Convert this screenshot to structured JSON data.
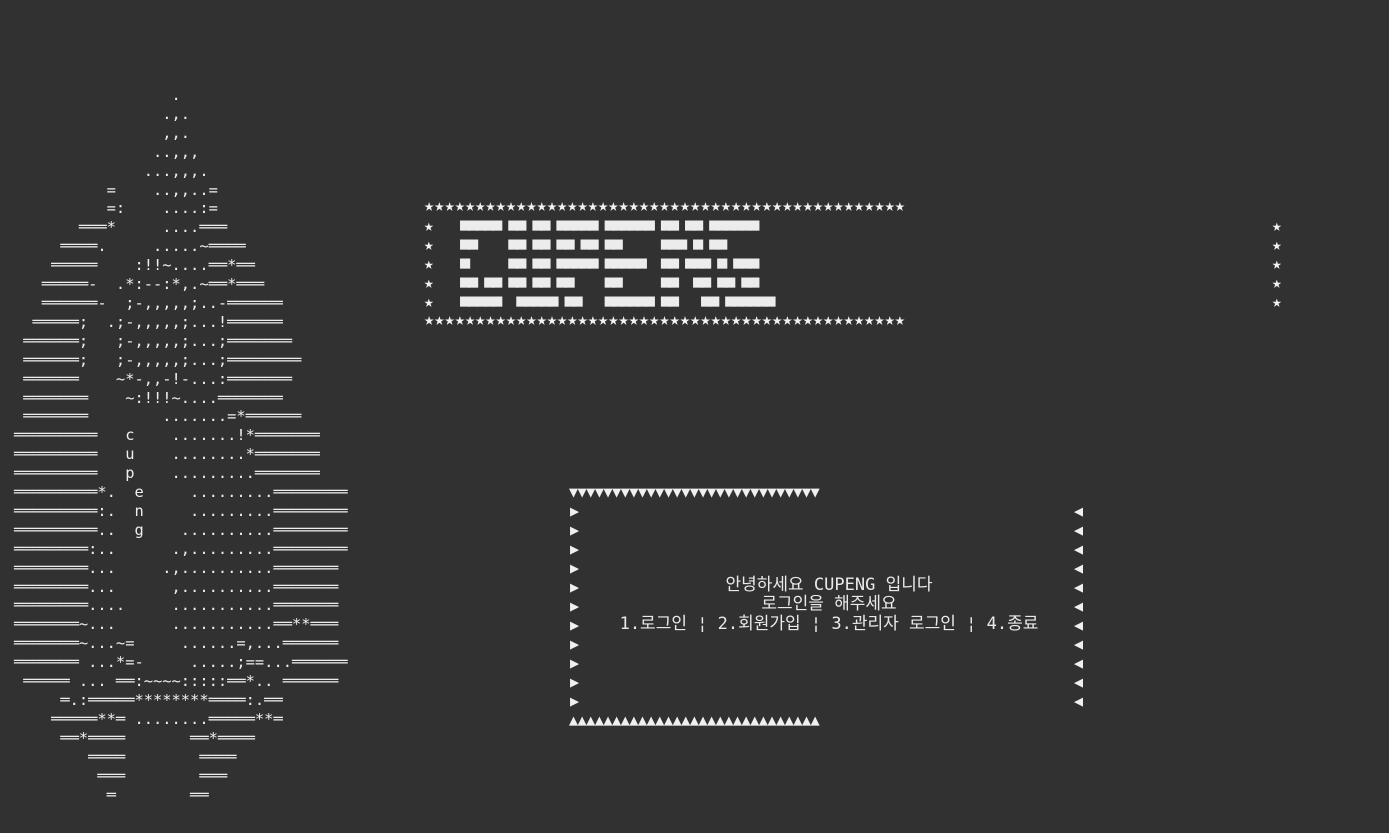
{
  "ascii_art": {
    "lines": [
      "                 .",
      "                .,.",
      "                ,,.",
      "               ..,,,",
      "              ...,,,.",
      "          =    ..,,..=",
      "          =:    ....:=",
      "       ═══*     ....═══",
      "     ════.     .....~════",
      "    ═════    :!!~....══*══",
      "   ═════-  .*:--:*,.~══*═══",
      "   ══════-  ;-,,,,,;..-══════",
      "  ═════;  .;-,,,,,;...!══════",
      " ══════;   ;-,,,,,;...;═══════",
      " ══════;   ;-,,,,,;...;════════",
      " ══════    ~*-,,-!-...:═══════",
      " ═══════    ~:!!!~....═══════",
      " ═══════        .......=*══════",
      "═════════   c    .......!*═══════",
      "═════════   u    ........*═══════",
      "═════════   p    .........═══════",
      "═════════*.  e     .........════════",
      "═════════:.  n     .........════════",
      "═════════..  g    ..........════════",
      "════════:..      .,.........════════",
      "════════...     .,..........═══════",
      "════════...      ,..........═══════",
      "════════....     ...........═══════",
      "═══════~...      ...........══**═══",
      "═══════~...~=     ......=,...══════",
      "═══════ ...*=-     .....;==...══════",
      " ═════ ... ══:~~~~:::::══*.. ══════",
      "     ═.:═════********════:.══",
      "    ═════**═ ........═════**═",
      "     ══*════       ══*════",
      "        ════        ════",
      "         ═══        ═══",
      "          ═        ══"
    ]
  },
  "banner": {
    "star_rows": {
      "top": "★★★★★★★★★★★★★★★★★★★★★★★★★★★★★★★★★★★★★★★★★★★★★★★",
      "bottom": "★★★★★★★★★★★★★★★★★★★★★★★★★★★★★★★★★★★★★★★★★★★★★★★"
    },
    "side_star": "★",
    "word": "CUPENG",
    "letter_rows": [
      "■■■■■ ■■ ■■ ■■■■■ ■■■■■■ ■■ ■■ ■■■■■■",
      "■■    ■■ ■■ ■■ ■■ ■■     ■■■ ■ ■■",
      "■     ■■ ■■ ■■■■■ ■■■■■  ■■ ■■■ ■ ■■■",
      "■■ ■■ ■■ ■■ ■■    ■■     ■■  ■■ ■■ ■■",
      "■■■■■  ■■■■■ ■■   ■■■■■■ ■■   ■■ ■■■■■■"
    ]
  },
  "menu": {
    "top_edge": "▼▼▼▼▼▼▼▼▼▼▼▼▼▼▼▼▼▼▼▼▼▼▼▼▼▼▼▼▼",
    "bottom_edge": "▲▲▲▲▲▲▲▲▲▲▲▲▲▲▲▲▲▲▲▲▲▲▲▲▲▲▲▲▲",
    "left_marker": "▶",
    "right_marker": "◀",
    "greeting": "안녕하세요 CUPENG 입니다",
    "prompt": "로그인을 해주세요",
    "options": "1.로그인 ¦ 2.회원가입 ¦ 3.관리자 로그인 ¦ 4.종료"
  },
  "colors": {
    "background": "#313131",
    "text": "#e8e8e8"
  }
}
